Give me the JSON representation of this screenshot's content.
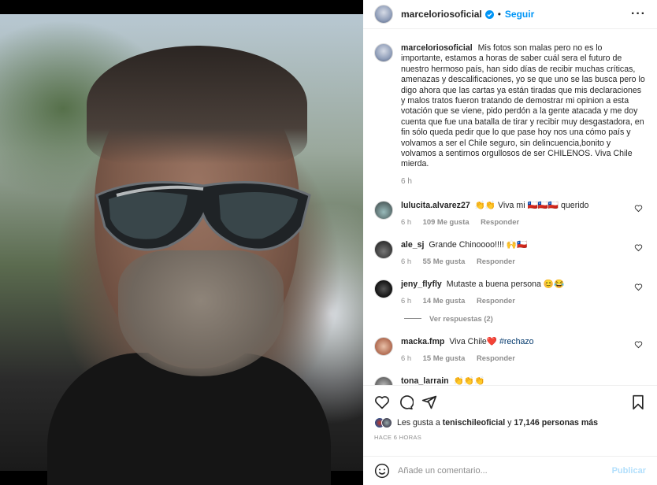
{
  "post": {
    "username": "marceloriosoficial",
    "follow_label": "Seguir",
    "more_label": "···",
    "caption_user": "marceloriosoficial",
    "caption_text": "Mis fotos son malas pero no es lo importante, estamos a horas de saber cuál sera el futuro de nuestro hermoso país, han sido días de recibir muchas críticas, amenazas y descalificaciones, yo se que uno se las busca pero lo digo ahora que las cartas ya están tiradas que mis declaraciones y malos tratos fueron tratando de demostrar mi opinion a esta votación que se viene, pido perdón a la gente atacada y me doy cuenta que fue una batalla de tirar y recibir muy desgastadora, en fin sólo queda pedir que lo que pase hoy nos una cómo país y volvamos a ser el Chile seguro, sin delincuencia,bonito y volvamos a sentirnos orgullosos de ser CHILENOS. Viva Chile mierda.",
    "caption_time": "6 h"
  },
  "comments": [
    {
      "user": "lulucita.alvarez27",
      "text": "👏👏 Viva mi 🇨🇱🇨🇱🇨🇱 querido",
      "time": "6 h",
      "likes": "109 Me gusta",
      "reply": "Responder"
    },
    {
      "user": "ale_sj",
      "text": "Grande Chinoooo!!!! 🙌🇨🇱",
      "time": "6 h",
      "likes": "55 Me gusta",
      "reply": "Responder"
    },
    {
      "user": "jeny_flyfly",
      "text": "Mutaste a buena persona 😊😂",
      "time": "6 h",
      "likes": "14 Me gusta",
      "reply": "Responder",
      "view_replies": "Ver respuestas (2)"
    },
    {
      "user": "macka.fmp",
      "text": "Viva Chile❤️",
      "hashtag": "#rechazo",
      "time": "6 h",
      "likes": "15 Me gusta",
      "reply": "Responder"
    },
    {
      "user": "tona_larrain",
      "text": "👏👏👏",
      "time": "",
      "likes": "",
      "reply": ""
    }
  ],
  "likes": {
    "prefix": "Les gusta a",
    "user": "tenischileoficial",
    "middle": "y",
    "count": "17,146 personas más"
  },
  "time_ago": "HACE 6 HORAS",
  "add_comment": {
    "placeholder": "Añade un comentario...",
    "publish_label": "Publicar"
  },
  "colors": {
    "link": "#0095f6",
    "muted": "#8e8e8e",
    "text": "#262626"
  }
}
